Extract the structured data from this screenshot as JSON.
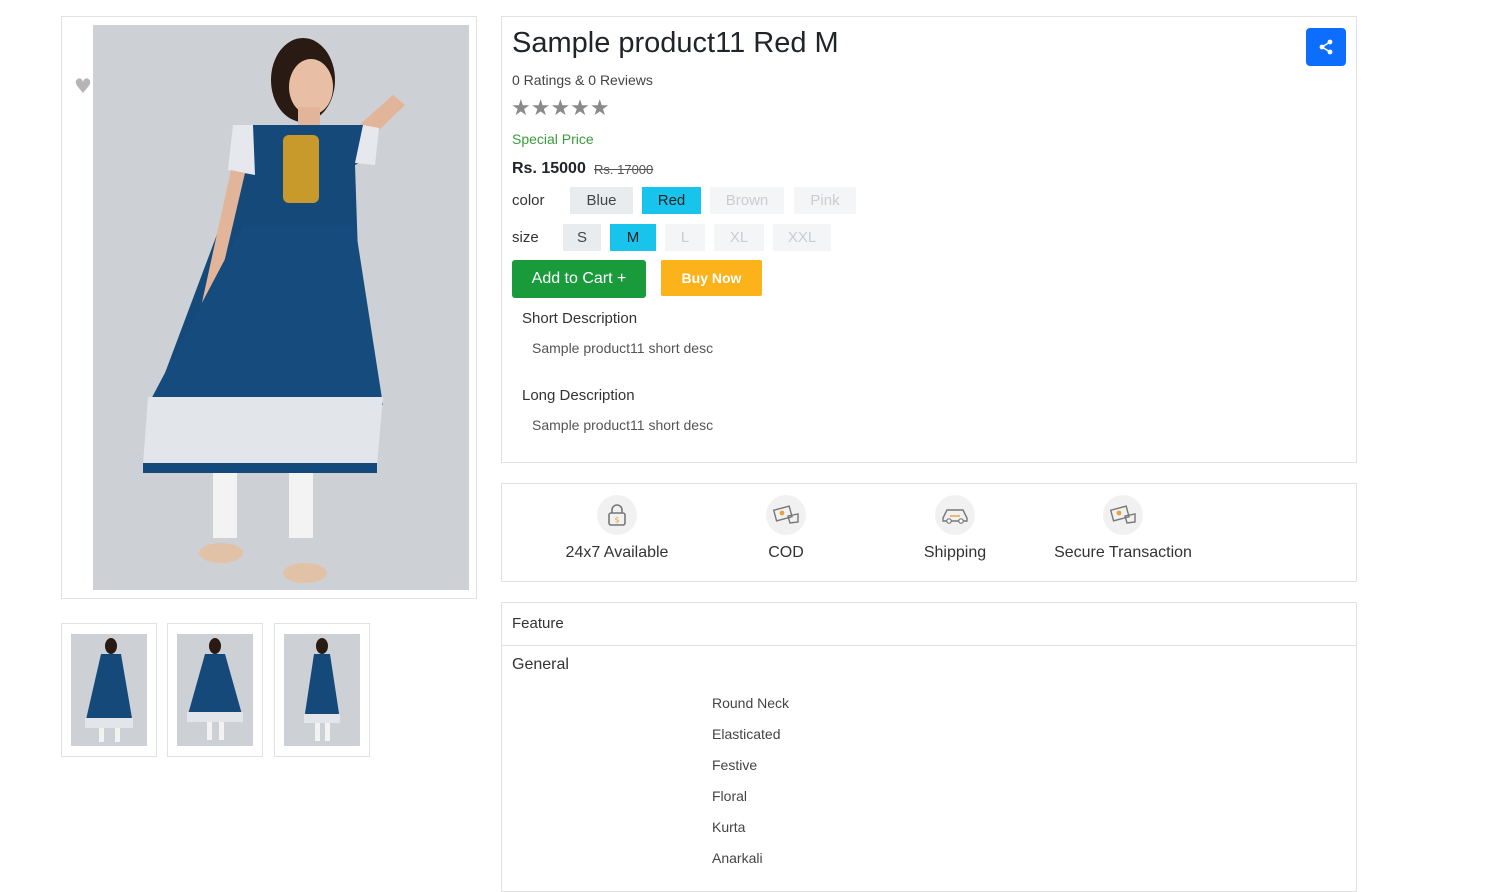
{
  "product": {
    "title": "Sample product11 Red M",
    "ratings": "0 Ratings & 0 Reviews",
    "stars": "★★★★★",
    "rating_value": 0,
    "special_price_label": "Special Price",
    "price": "Rs. 15000",
    "old_price": "Rs. 17000",
    "color_label": "color",
    "colors": [
      {
        "label": "Blue",
        "state": "available"
      },
      {
        "label": "Red",
        "state": "selected"
      },
      {
        "label": "Brown",
        "state": "disabled"
      },
      {
        "label": "Pink",
        "state": "disabled"
      }
    ],
    "size_label": "size",
    "sizes": [
      {
        "label": "S",
        "state": "available"
      },
      {
        "label": "M",
        "state": "selected"
      },
      {
        "label": "L",
        "state": "disabled"
      },
      {
        "label": "XL",
        "state": "disabled"
      },
      {
        "label": "XXL",
        "state": "disabled"
      }
    ],
    "add_to_cart": "Add to Cart +",
    "buy_now": "Buy Now",
    "short_desc_title": "Short Description",
    "short_desc": "Sample product11 short desc",
    "long_desc_title": "Long Description",
    "long_desc": "Sample product11 short desc"
  },
  "icons": {
    "wishlist": "heart-icon",
    "share": "share-icon"
  },
  "services": [
    {
      "label": "24x7 Available",
      "icon": "lock-icon"
    },
    {
      "label": "COD",
      "icon": "cash-icon"
    },
    {
      "label": "Shipping",
      "icon": "truck-icon"
    },
    {
      "label": "Secure Transaction",
      "icon": "cash-icon"
    }
  ],
  "specs": {
    "header": "Feature",
    "group": "General",
    "values": [
      "Round Neck",
      "Elasticated",
      "Festive",
      "Floral",
      "Kurta",
      "Anarkali"
    ]
  },
  "colors": {
    "primary": "#0d6efd",
    "cart_green": "#1a9b3b",
    "buy_orange": "#fbb21b",
    "selected_chip": "#19c4ec",
    "special_price": "#3a9b3a",
    "dress_blue": "#14497a"
  }
}
